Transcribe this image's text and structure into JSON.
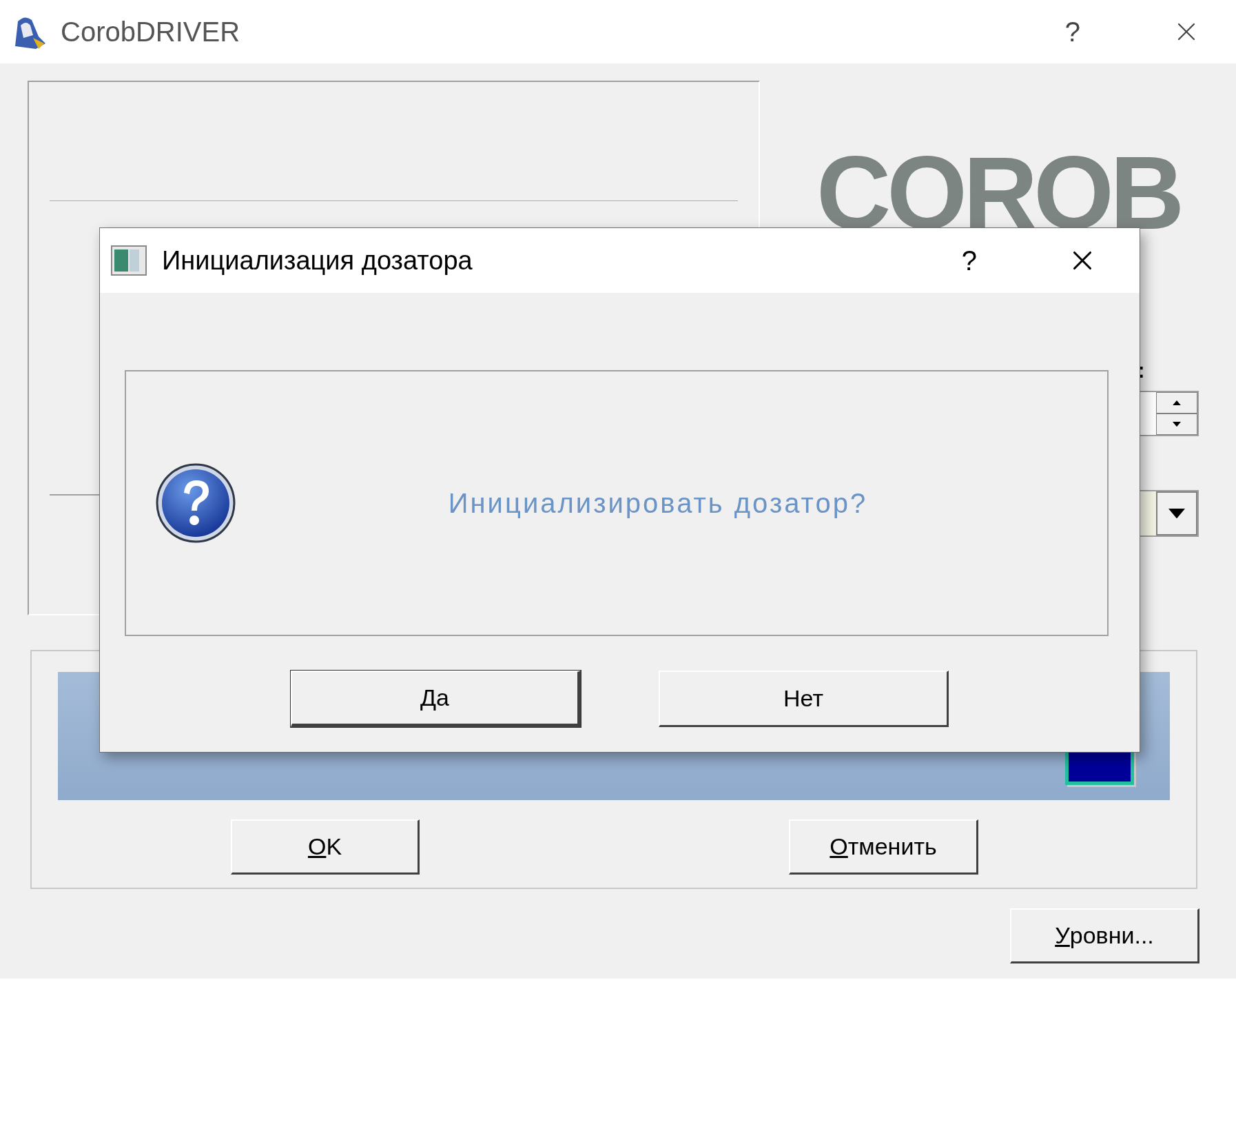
{
  "window": {
    "title": "CorobDRIVER",
    "help": "?"
  },
  "logo": "COROB",
  "right_panel": {
    "label_fragment": ":"
  },
  "buttons": [
    {
      "label": "OK",
      "mnemonic": true
    },
    {
      "label": "Отменить",
      "mnemonic": true
    }
  ],
  "levels_button": {
    "label": "Уровни...",
    "mnemonic": true
  },
  "dialog": {
    "title": "Инициализация дозатора",
    "help": "?",
    "message": "Инициализировать дозатор?",
    "buttons": [
      {
        "label": "Да",
        "default": true
      },
      {
        "label": "Нет",
        "default": false
      }
    ]
  }
}
